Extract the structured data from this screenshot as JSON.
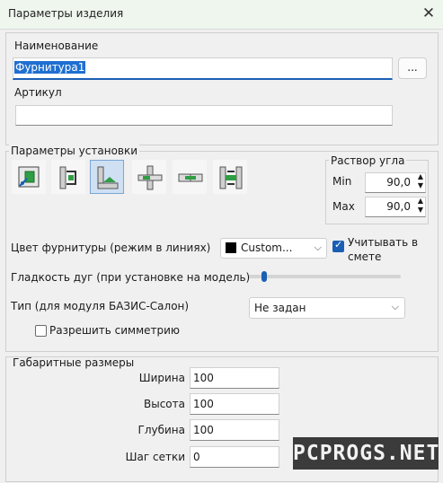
{
  "window": {
    "title": "Параметры изделия",
    "close_icon": "close-icon"
  },
  "name_section": {
    "name_label": "Наименование",
    "name_value": "Фурнитура1",
    "browse_label": "...",
    "article_label": "Артикул",
    "article_value": ""
  },
  "install": {
    "group_label": "Параметры установки",
    "icons": [
      "install-mode-1-icon",
      "install-mode-2-icon",
      "install-mode-3-icon",
      "install-mode-4-icon",
      "install-mode-5-icon",
      "install-mode-6-icon"
    ],
    "active_index": 2,
    "angle": {
      "label": "Раствор угла",
      "min_label": "Min",
      "min_value": "90,0",
      "max_label": "Max",
      "max_value": "90,0"
    },
    "color_label": "Цвет фурнитуры (режим в линиях)",
    "color_value": "Custom...",
    "color_swatch": "#000000",
    "estimate_label_1": "Учитывать в",
    "estimate_label_2": "смете",
    "estimate_checked": true,
    "smoothness_label": "Гладкость дуг (при установке на модель)",
    "smoothness_level": 0.03,
    "type_label": "Тип (для модуля БАЗИС-Салон)",
    "type_value": "Не задан",
    "symmetry_label": "Разрешить симметрию",
    "symmetry_checked": false
  },
  "dimensions": {
    "group_label": "Габаритные размеры",
    "rows": [
      {
        "label": "Ширина",
        "value": "100"
      },
      {
        "label": "Высота",
        "value": "100"
      },
      {
        "label": "Глубина",
        "value": "100"
      },
      {
        "label": "Шаг сетки",
        "value": "0"
      }
    ]
  },
  "watermark": "PCPROGS.NET",
  "colors": {
    "accent": "#1f6fd1",
    "check": "#1a5fb4",
    "title_bg": "#eef6ee"
  }
}
